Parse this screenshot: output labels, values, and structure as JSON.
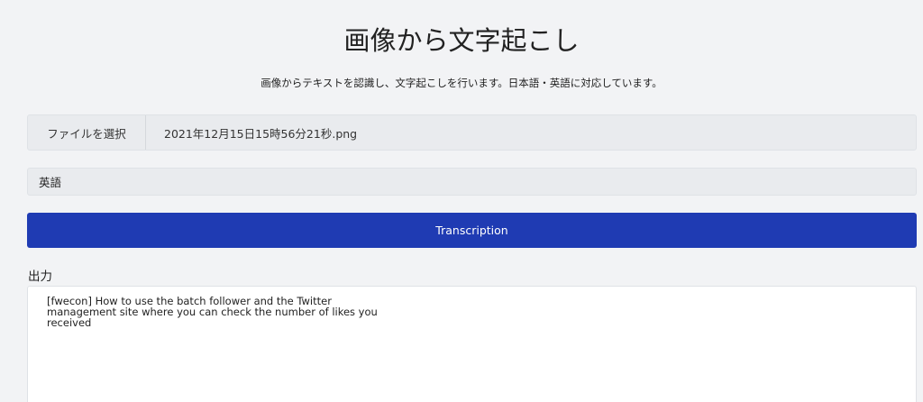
{
  "page": {
    "title": "画像から文字起こし",
    "subtitle": "画像からテキストを認識し、文字起こしを行います。日本語・英語に対応しています。"
  },
  "file_input": {
    "button_label": "ファイルを選択",
    "file_name": "2021年12月15日15時56分21秒.png"
  },
  "language_select": {
    "selected": "英語"
  },
  "submit": {
    "label": "Transcription"
  },
  "output": {
    "label": "出力",
    "text": "[fwecon] How to use the batch follower and the Twitter management site where you can check the number of likes you received"
  },
  "colors": {
    "background": "#f2f3f5",
    "field_background": "#e9ebee",
    "accent": "#1f3bb3",
    "output_background": "#ffffff"
  }
}
